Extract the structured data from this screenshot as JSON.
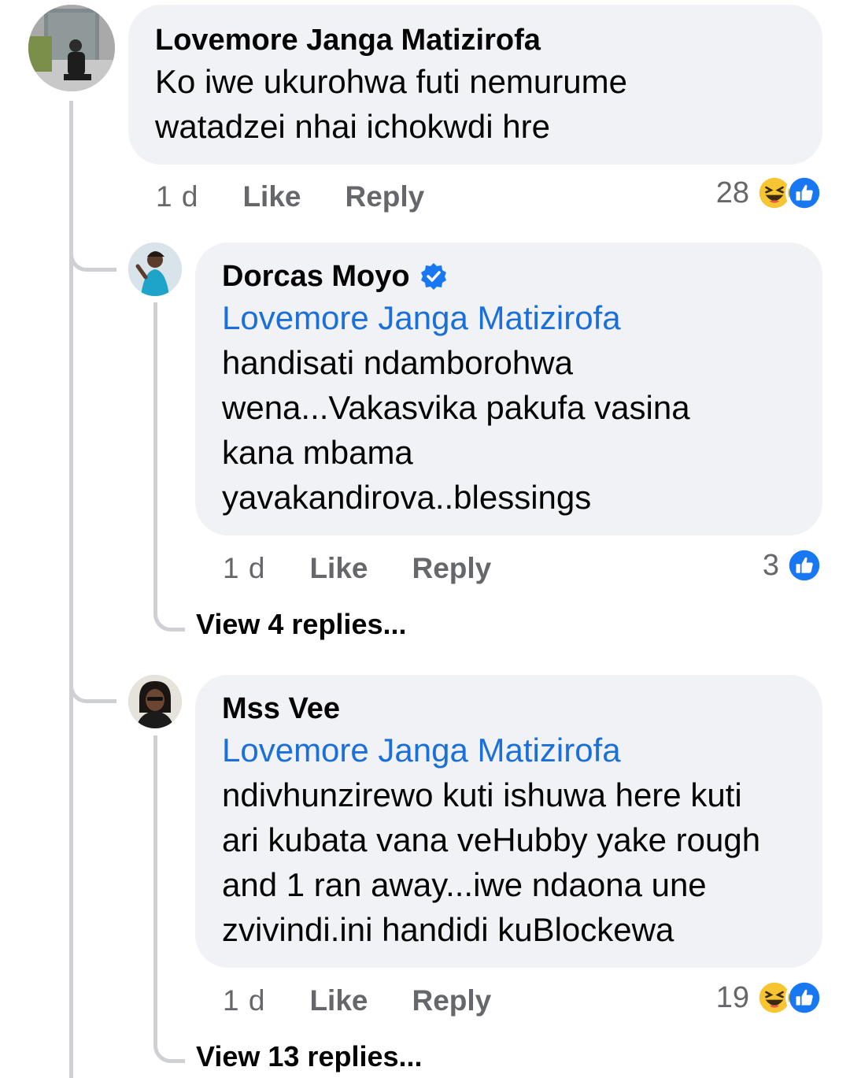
{
  "comment": {
    "author": "Lovemore Janga Matizirofa",
    "text_line1": "Ko iwe ukurohwa futi nemurume",
    "text_line2": "watadzei nhai ichokwdi hre",
    "time": "1 d",
    "like_label": "Like",
    "reply_label": "Reply",
    "reaction_count": "28",
    "reactions": [
      "haha-icon",
      "like-icon"
    ]
  },
  "replies": [
    {
      "author": "Dorcas Moyo",
      "verified": true,
      "mention": "Lovemore Janga Matizirofa",
      "lines": [
        "handisati ndamborohwa",
        "wena...Vakasvika pakufa vasina",
        "kana mbama",
        "yavakandirova..blessings"
      ],
      "time": "1 d",
      "like_label": "Like",
      "reply_label": "Reply",
      "reaction_count": "3",
      "reactions": [
        "like-icon"
      ],
      "view_replies": "View 4 replies..."
    },
    {
      "author": "Mss Vee",
      "verified": false,
      "mention": "Lovemore Janga Matizirofa",
      "lines": [
        "ndivhunzirewo kuti ishuwa here kuti",
        "ari kubata vana veHubby yake rough",
        "and 1 ran away...iwe ndaona une",
        "zvivindi.ini handidi kuBlockewa"
      ],
      "time": "1 d",
      "like_label": "Like",
      "reply_label": "Reply",
      "reaction_count": "19",
      "reactions": [
        "haha-icon",
        "like-icon"
      ],
      "view_replies": "View 13 replies..."
    }
  ],
  "colors": {
    "bubble": "#f0f2f5",
    "mention": "#1b6fd8",
    "meta": "#65676b",
    "like_blue": "#1877f2",
    "haha_yellow": "#f7c531"
  }
}
